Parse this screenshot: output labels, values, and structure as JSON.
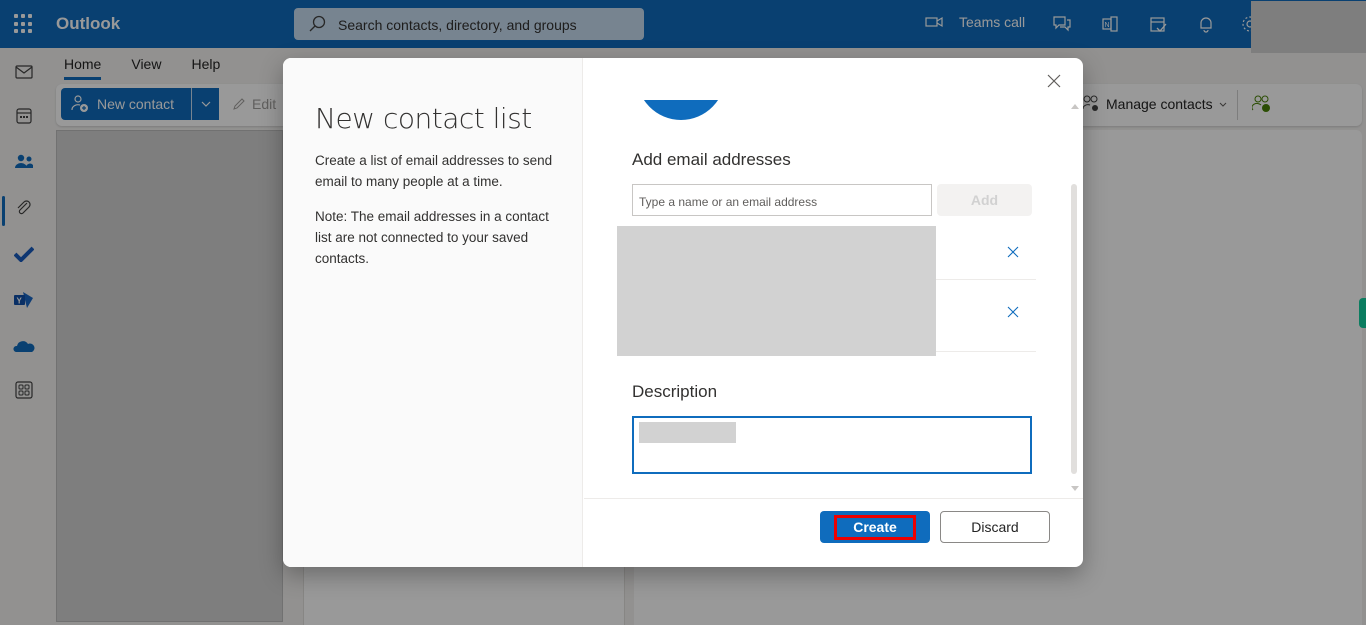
{
  "app": {
    "name": "Outlook",
    "search_placeholder": "Search contacts, directory, and groups",
    "teams_call_label": "Teams call",
    "accent_color": "#0f6cbd"
  },
  "rail": {
    "items": [
      "mail",
      "calendar",
      "people",
      "files",
      "to-do",
      "yammer",
      "onedrive",
      "more-apps"
    ],
    "active": "people"
  },
  "ribbon": {
    "tabs": [
      {
        "label": "Home",
        "active": true
      },
      {
        "label": "View",
        "active": false
      },
      {
        "label": "Help",
        "active": false
      }
    ],
    "new_contact_label": "New contact",
    "edit_label": "Edit",
    "manage_contacts_label": "Manage contacts"
  },
  "dialog": {
    "title": "New contact list",
    "description": "Create a list of email addresses to send email to many people at a time.",
    "note": "Note: The email addresses in a contact list are not connected to your saved contacts.",
    "add_section_title": "Add email addresses",
    "email_input_placeholder": "Type a name or an email address",
    "add_button_label": "Add",
    "recipient_count": 2,
    "description_section_title": "Description",
    "create_button_label": "Create",
    "discard_button_label": "Discard",
    "highlight_color": "#e00000"
  }
}
